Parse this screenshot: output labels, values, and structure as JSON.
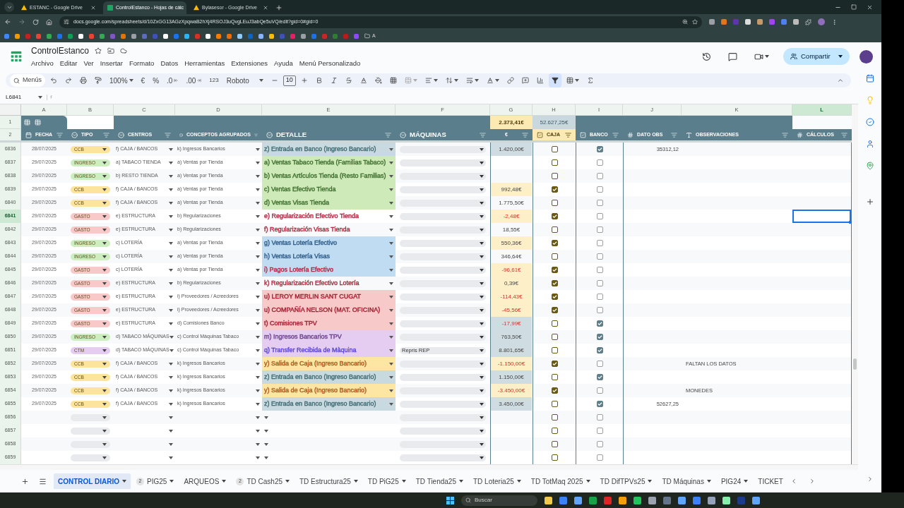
{
  "browser": {
    "tabs": [
      {
        "title": "ESTANC - Google Drive",
        "selected": false
      },
      {
        "title": "ControlEstanco - Hojas de cálc",
        "selected": true
      },
      {
        "title": "Bylasesor - Google Drive",
        "selected": false
      }
    ],
    "url": "docs.google.com/spreadsheets/d/10ZxGG13AGzXpqwaB2hXj4RSOJ3uQvgLEuJ3abQe5uVQ/edit?gid=0#gid=0",
    "bookmark_end_label": "A"
  },
  "app": {
    "title": "ControlEstanco",
    "menus": [
      "Archivo",
      "Editar",
      "Ver",
      "Insertar",
      "Formato",
      "Datos",
      "Herramientas",
      "Extensiones",
      "Ayuda",
      "Menú Personalizado"
    ],
    "share_label": "Compartir"
  },
  "toolbar": {
    "search": "Menús",
    "zoom": "100%",
    "currency": "€",
    "percent": "%",
    "decrease_decimals": ".0",
    "increase_decimals": ".00",
    "number_format": "123",
    "font": "Roboto",
    "font_size": "10",
    "filter_on": true
  },
  "name_box": "L6841",
  "columns": [
    {
      "letter": "A",
      "selected": false
    },
    {
      "letter": "B",
      "selected": false
    },
    {
      "letter": "C",
      "selected": false
    },
    {
      "letter": "D",
      "selected": false
    },
    {
      "letter": "E",
      "selected": false
    },
    {
      "letter": "F",
      "selected": false
    },
    {
      "letter": "G",
      "selected": false
    },
    {
      "letter": "H",
      "selected": false
    },
    {
      "letter": "I",
      "selected": false
    },
    {
      "letter": "J",
      "selected": false
    },
    {
      "letter": "K",
      "selected": false
    },
    {
      "letter": "L",
      "selected": true
    }
  ],
  "totals": {
    "caja": "2.373,41€",
    "banco": "52.627,25€"
  },
  "header_rows": [
    "1",
    "2"
  ],
  "headers": [
    {
      "label": "FECHA",
      "kind": "date"
    },
    {
      "label": "TIPO",
      "kind": "chip"
    },
    {
      "label": "CENTROS",
      "kind": "chip"
    },
    {
      "label": "CONCEPTOS AGRUPADOS",
      "kind": "chip"
    },
    {
      "label": "DETALLE",
      "kind": "chip"
    },
    {
      "label": "MÁQUINAS",
      "kind": "chip"
    },
    {
      "label": "€",
      "kind": "plain"
    },
    {
      "label": "CAJA",
      "kind": "check",
      "color": "#fdeab3"
    },
    {
      "label": "BANCO",
      "kind": "check"
    },
    {
      "label": "DATO OBS",
      "kind": "number"
    },
    {
      "label": "OBSERVACIONES",
      "kind": "text"
    },
    {
      "label": "CÁLCULOS",
      "kind": "number"
    }
  ],
  "rows": [
    {
      "num": "6836",
      "date": "28/07/2025",
      "tipo": {
        "label": "CCB",
        "color": "#fde49c"
      },
      "centro": "f) CAJA / BANCOS",
      "concepto": "k) Ingresos Bancarios",
      "detalle": {
        "color": "#c8dadf",
        "label": {
          "text": "z) Entrada en Banco (Ingreso Bancario)",
          "color": "#3f6a72"
        }
      },
      "amount": {
        "text": "1.420,00€",
        "color": "#cfdde2",
        "negative": false
      },
      "caja": false,
      "banco": true,
      "dato_obs": "35312,12",
      "selected": false
    },
    {
      "num": "6837",
      "date": "29/07/2025",
      "tipo": {
        "label": "INGRESO",
        "color": "#cdeebf"
      },
      "centro": "a) TABACO TIENDA",
      "concepto": "a) Ventas por Tienda",
      "detalle": {
        "color": "#cfeab9",
        "label": {
          "text": "a) Ventas Tabaco Tienda (Familias Tabaco)",
          "color": "#3c6d2c"
        }
      },
      "caja": false,
      "banco": false,
      "selected": false
    },
    {
      "num": "6838",
      "date": "29/07/2025",
      "tipo": {
        "label": "INGRESO",
        "color": "#cdeebf"
      },
      "centro": "b) RESTO TIENDA",
      "concepto": "a) Ventas por Tienda",
      "detalle": {
        "color": "#cfeab9",
        "label": {
          "text": "b) Ventas Artículos Tienda (Resto Familias)",
          "color": "#3c6d2c"
        }
      },
      "caja": false,
      "banco": false,
      "selected": false
    },
    {
      "num": "6839",
      "date": "29/07/2025",
      "tipo": {
        "label": "CCB",
        "color": "#fde49c"
      },
      "centro": "f) CAJA / BANCOS",
      "concepto": "a) Ventas por Tienda",
      "detalle": {
        "color": "#cfeab9",
        "label": {
          "text": "c) Ventas Efectivo Tienda",
          "color": "#3c6d2c"
        }
      },
      "amount": {
        "text": "992,48€",
        "color": "#fdf0c8",
        "negative": false
      },
      "caja": true,
      "banco": false,
      "selected": false
    },
    {
      "num": "6840",
      "date": "29/07/2025",
      "tipo": {
        "label": "CCB",
        "color": "#fde49c"
      },
      "centro": "f) CAJA / BANCOS",
      "concepto": "a) Ventas por Tienda",
      "detalle": {
        "color": "#cfeab9",
        "label": {
          "text": "d) Ventas Visas Tienda",
          "color": "#3c6d2c"
        }
      },
      "amount": {
        "text": "1.775,50€",
        "negative": false
      },
      "caja": false,
      "banco": false,
      "selected": false
    },
    {
      "num": "6841",
      "date": "29/07/2025",
      "tipo": {
        "label": "GASTO",
        "color": "#f9c8c8"
      },
      "centro": "e) ESTRUCTURA",
      "concepto": "b) Regularizaciones",
      "detalle": {
        "label": {
          "text": "e) Regularización Efectivo Tienda",
          "color": "#b0263f"
        }
      },
      "amount": {
        "text": "-2,48€",
        "color": "#fdf0c8",
        "negative": true
      },
      "caja": true,
      "banco": false,
      "selected": true
    },
    {
      "num": "6842",
      "date": "29/07/2025",
      "tipo": {
        "label": "GASTO",
        "color": "#f9c8c8"
      },
      "centro": "e) ESTRUCTURA",
      "concepto": "b) Regularizaciones",
      "detalle": {
        "label": {
          "text": "f) Regularización Visas Tienda",
          "color": "#b0263f"
        }
      },
      "amount": {
        "text": "18,55€",
        "negative": false
      },
      "caja": false,
      "banco": false,
      "selected": false
    },
    {
      "num": "6843",
      "date": "29/07/2025",
      "tipo": {
        "label": "INGRESO",
        "color": "#cdeebf"
      },
      "centro": "c) LOTERÍA",
      "concepto": "a) Ventas por Tienda",
      "detalle": {
        "color": "#c0dcf2",
        "label": {
          "text": "g) Ventas Lotería Efectivo",
          "color": "#2c5a86"
        }
      },
      "amount": {
        "text": "550,36€",
        "color": "#fdf0c8",
        "negative": false
      },
      "caja": true,
      "banco": false,
      "selected": false
    },
    {
      "num": "6844",
      "date": "29/07/2025",
      "tipo": {
        "label": "INGRESO",
        "color": "#cdeebf"
      },
      "centro": "c) LOTERÍA",
      "concepto": "a) Ventas por Tienda",
      "detalle": {
        "color": "#c0dcf2",
        "label": {
          "text": "h) Ventas Lotería Visas",
          "color": "#2c5a86"
        }
      },
      "amount": {
        "text": "346,64€",
        "negative": false
      },
      "caja": false,
      "banco": false,
      "selected": false
    },
    {
      "num": "6845",
      "date": "29/07/2025",
      "tipo": {
        "label": "GASTO",
        "color": "#f9c8c8"
      },
      "centro": "c) LOTERÍA",
      "concepto": "a) Ventas por Tienda",
      "detalle": {
        "color": "#c0dcf2",
        "label": {
          "text": "i) Pagos Lotería Efectivo",
          "color": "#b0263f"
        }
      },
      "amount": {
        "text": "-96,61€",
        "color": "#fdf0c8",
        "negative": true
      },
      "caja": true,
      "banco": false,
      "selected": false
    },
    {
      "num": "6846",
      "date": "29/07/2025",
      "tipo": {
        "label": "GASTO",
        "color": "#f9c8c8"
      },
      "centro": "e) ESTRUCTURA",
      "concepto": "b) Regularizaciones",
      "detalle": {
        "label": {
          "text": "k) Regularización Efectivo Lotería",
          "color": "#b0263f"
        }
      },
      "amount": {
        "text": "0,39€",
        "color": "#fdf0c8",
        "negative": false
      },
      "caja": true,
      "banco": false,
      "selected": false
    },
    {
      "num": "6847",
      "date": "29/07/2025",
      "tipo": {
        "label": "GASTO",
        "color": "#f9c8c8"
      },
      "centro": "e) ESTRUCTURA",
      "concepto": "i) Proveedores / Acreedores",
      "detalle": {
        "color": "#f8c9c9",
        "label": {
          "text": "u) LEROY MERLIN SANT CUGAT",
          "color": "#a01d2e"
        }
      },
      "amount": {
        "text": "-114,43€",
        "color": "#fdf0c8",
        "negative": true
      },
      "caja": true,
      "banco": false,
      "selected": false
    },
    {
      "num": "6848",
      "date": "29/07/2025",
      "tipo": {
        "label": "GASTO",
        "color": "#f9c8c8"
      },
      "centro": "e) ESTRUCTURA",
      "concepto": "i) Proveedores / Acreedores",
      "detalle": {
        "color": "#f8c9c9",
        "label": {
          "text": "u) COMPAÑÍA NELSON (MAT. OFICINA)",
          "color": "#a01d2e"
        }
      },
      "amount": {
        "text": "-45,56€",
        "color": "#fdf0c8",
        "negative": true
      },
      "caja": true,
      "banco": false,
      "selected": false
    },
    {
      "num": "6849",
      "date": "29/07/2025",
      "tipo": {
        "label": "GASTO",
        "color": "#f9c8c8"
      },
      "centro": "e) ESTRUCTURA",
      "concepto": "d) Comisiones Banco",
      "detalle": {
        "color": "#f8c9c9",
        "label": {
          "text": "t) Comisiones TPV",
          "color": "#a01d2e"
        }
      },
      "amount": {
        "text": "-17,99€",
        "color": "#cfdde2",
        "negative": true
      },
      "caja": false,
      "banco": true,
      "selected": false
    },
    {
      "num": "6850",
      "date": "29/07/2025",
      "tipo": {
        "label": "INGRESO",
        "color": "#cdeebf"
      },
      "centro": "d) TABACO MÁQUINAS",
      "concepto": "c) Control Máquinas Tabaco",
      "detalle": {
        "color": "#e4cdf1",
        "label": {
          "text": "m) Ingresos Bancarios TPV",
          "color": "#6b4189"
        }
      },
      "amount": {
        "text": "763,50€",
        "color": "#cfdde2",
        "negative": false
      },
      "caja": false,
      "banco": true,
      "selected": false
    },
    {
      "num": "6851",
      "date": "29/07/2025",
      "tipo": {
        "label": "CTM",
        "color": "#e4cdf1"
      },
      "centro": "d) TABACO MÁQUINAS",
      "concepto": "c) Control Máquinas Tabaco",
      "detalle": {
        "color": "#e4cdf1",
        "label": {
          "text": "q) Transfer Recibida de Màquina",
          "color": "#5a46d4"
        }
      },
      "maquina": "Repris REP",
      "amount": {
        "text": "8.801,65€",
        "color": "#cfdde2",
        "negative": false
      },
      "caja": false,
      "banco": true,
      "selected": false
    },
    {
      "num": "6852",
      "date": "29/07/2025",
      "tipo": {
        "label": "CCB",
        "color": "#fde49c"
      },
      "centro": "f) CAJA / BANCOS",
      "concepto": "k) Ingresos Bancarios",
      "detalle": {
        "color": "#fde6a4",
        "label": {
          "text": "y) Salida de Caja (Ingreso Bancario)",
          "color": "#b4551b"
        }
      },
      "amount": {
        "text": "-1.150,00€",
        "color": "#fdf0c8",
        "negative": true
      },
      "caja": true,
      "banco": false,
      "observaciones": "FALTAN LOS DATOS",
      "selected": false
    },
    {
      "num": "6853",
      "date": "29/07/2025",
      "tipo": {
        "label": "CCB",
        "color": "#fde49c"
      },
      "centro": "f) CAJA / BANCOS",
      "concepto": "k) Ingresos Bancarios",
      "detalle": {
        "color": "#c8dadf",
        "label": {
          "text": "z) Entrada en Banco (Ingreso Bancario)",
          "color": "#3f6a72"
        }
      },
      "amount": {
        "text": "1.150,00€",
        "color": "#cfdde2",
        "negative": false
      },
      "caja": false,
      "banco": true,
      "selected": false
    },
    {
      "num": "6854",
      "date": "29/07/2025",
      "tipo": {
        "label": "CCB",
        "color": "#fde49c"
      },
      "centro": "f) CAJA / BANCOS",
      "concepto": "k) Ingresos Bancarios",
      "detalle": {
        "color": "#fde6a4",
        "label": {
          "text": "y) Salida de Caja (Ingreso Bancario)",
          "color": "#b4551b"
        }
      },
      "amount": {
        "text": "-3.450,00€",
        "color": "#fdf0c8",
        "negative": true
      },
      "caja": true,
      "banco": false,
      "observaciones": "MONEDES",
      "selected": false
    },
    {
      "num": "6855",
      "date": "29/07/2025",
      "tipo": {
        "label": "CCB",
        "color": "#fde49c"
      },
      "centro": "f) CAJA / BANCOS",
      "concepto": "k) Ingresos Bancarios",
      "detalle": {
        "color": "#c8dadf",
        "label": {
          "text": "z) Entrada en Banco (Ingreso Bancario)",
          "color": "#3f6a72"
        }
      },
      "amount": {
        "text": "3.450,00€",
        "color": "#cfdde2",
        "negative": false
      },
      "caja": false,
      "banco": true,
      "dato_obs": "52627,25",
      "selected": false
    },
    {
      "num": "6856",
      "tipo": {
        "color": "#e8eaed"
      },
      "caja": false,
      "banco": false,
      "selected": false
    },
    {
      "num": "6857",
      "tipo": {
        "color": "#e8eaed"
      },
      "caja": false,
      "banco": false,
      "selected": false
    },
    {
      "num": "6858",
      "tipo": {
        "color": "#e8eaed"
      },
      "caja": false,
      "banco": false,
      "selected": false
    },
    {
      "num": "6859",
      "tipo": {
        "color": "#e8eaed"
      },
      "caja": false,
      "banco": false,
      "selected": false
    }
  ],
  "sheet_tabs": [
    {
      "label": "CONTROL DIARIO",
      "selected": true
    },
    {
      "label": "PIG25",
      "badge": "2",
      "selected": false
    },
    {
      "label": "ARQUEOS",
      "selected": false
    },
    {
      "label": "TD Cash25",
      "badge": "2",
      "selected": false
    },
    {
      "label": "TD Estructura25",
      "selected": false
    },
    {
      "label": "TD PiG25",
      "selected": false
    },
    {
      "label": "TD Tienda25",
      "selected": false
    },
    {
      "label": "TD Loteria25",
      "selected": false
    },
    {
      "label": "TD TotMaq 2025",
      "selected": false
    },
    {
      "label": "TD DifTPVs25",
      "selected": false
    },
    {
      "label": "TD Máquinas",
      "selected": false
    },
    {
      "label": "PIG24",
      "selected": false
    },
    {
      "label": "TICKET",
      "selected": false
    }
  ],
  "taskbar": {
    "search": "Buscar"
  }
}
